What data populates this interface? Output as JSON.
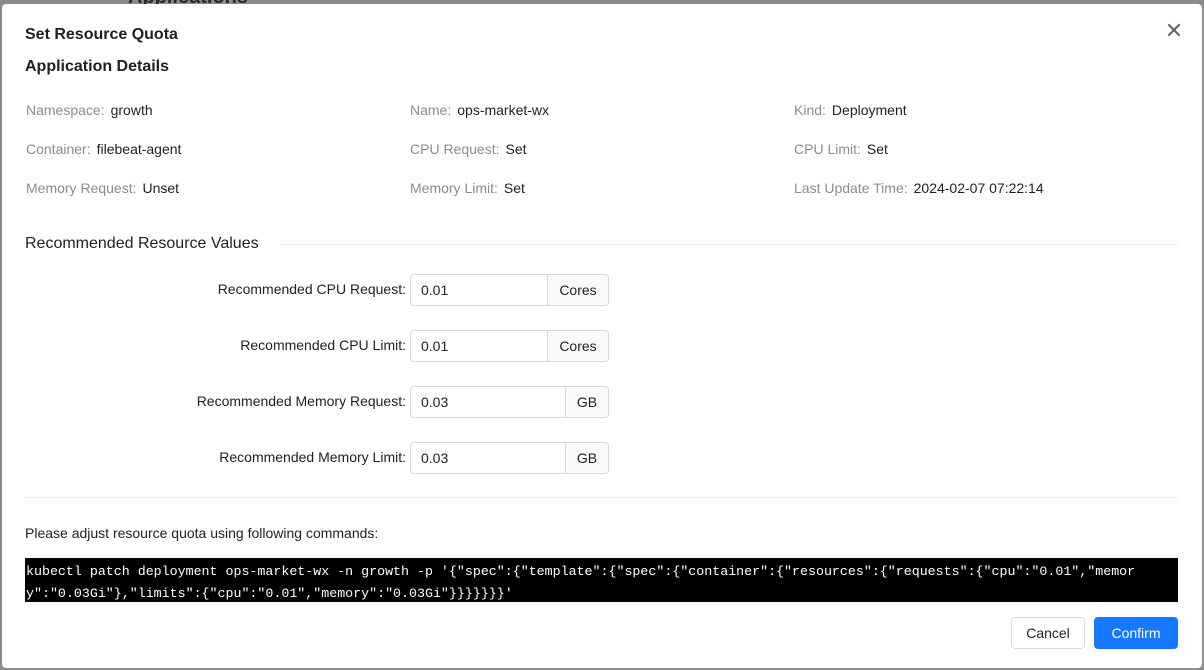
{
  "background": {
    "title": "Applications"
  },
  "modal": {
    "title": "Set Resource Quota",
    "close_icon": "close-icon"
  },
  "details": {
    "title": "Application Details",
    "fields": [
      {
        "label": "Namespace",
        "value": "growth"
      },
      {
        "label": "Name",
        "value": "ops-market-wx"
      },
      {
        "label": "Kind",
        "value": "Deployment"
      },
      {
        "label": "Container",
        "value": "filebeat-agent"
      },
      {
        "label": "CPU Request",
        "value": "Set"
      },
      {
        "label": "CPU Limit",
        "value": "Set"
      },
      {
        "label": "Memory Request",
        "value": "Unset"
      },
      {
        "label": "Memory Limit",
        "value": "Set"
      },
      {
        "label": "Last Update Time",
        "value": "2024-02-07 07:22:14"
      }
    ]
  },
  "recommended": {
    "title": "Recommended Resource Values",
    "rows": [
      {
        "label": "Recommended CPU Request",
        "value": "0.01",
        "unit": "Cores"
      },
      {
        "label": "Recommended CPU Limit",
        "value": "0.01",
        "unit": "Cores"
      },
      {
        "label": "Recommended Memory Request",
        "value": "0.03",
        "unit": "GB"
      },
      {
        "label": "Recommended Memory Limit",
        "value": "0.03",
        "unit": "GB"
      }
    ]
  },
  "command": {
    "intro": "Please adjust resource quota using following commands:",
    "text": "kubectl patch deployment ops-market-wx -n growth -p '{\"spec\":{\"template\":{\"spec\":{\"container\":{\"resources\":{\"requests\":{\"cpu\":\"0.01\",\"memory\":\"0.03Gi\"},\"limits\":{\"cpu\":\"0.01\",\"memory\":\"0.03Gi\"}}}}}}}'"
  },
  "footer": {
    "cancel_label": "Cancel",
    "confirm_label": "Confirm"
  },
  "colors": {
    "primary": "#1677ff",
    "overlay": "#8c8c8c",
    "command_bg": "#000000"
  }
}
